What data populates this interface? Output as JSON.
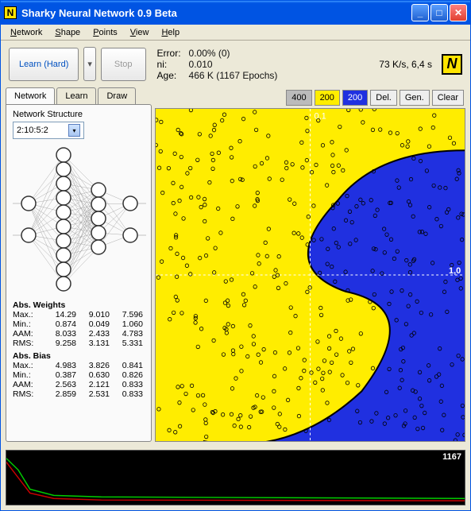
{
  "title": "Sharky Neural Network 0.9 Beta",
  "menu": {
    "network": "Network",
    "shape": "Shape",
    "points": "Points",
    "view": "View",
    "help": "Help"
  },
  "toolbar": {
    "learn": "Learn (Hard)",
    "drop": "▾",
    "stop": "Stop"
  },
  "stats": {
    "error_lbl": "Error:",
    "error": "0.00% (0)",
    "ni_lbl": "ni:",
    "ni": "0.010",
    "age_lbl": "Age:",
    "age": "466 K (1167 Epochs)"
  },
  "perf": "73 K/s, 6,4 s",
  "tabs": {
    "network": "Network",
    "learn": "Learn",
    "draw": "Draw"
  },
  "structure": {
    "label": "Network Structure",
    "value": "2:10:5:2"
  },
  "weights": {
    "title": "Abs. Weights",
    "rows": [
      {
        "n": "Max.:",
        "a": "14.29",
        "b": "9.010",
        "c": "7.596"
      },
      {
        "n": "Min.:",
        "a": "0.874",
        "b": "0.049",
        "c": "1.060"
      },
      {
        "n": "AAM:",
        "a": "8.033",
        "b": "2.433",
        "c": "4.783"
      },
      {
        "n": "RMS:",
        "a": "9.258",
        "b": "3.131",
        "c": "5.331"
      }
    ]
  },
  "bias": {
    "title": "Abs. Bias",
    "rows": [
      {
        "n": "Max.:",
        "a": "4.983",
        "b": "3.826",
        "c": "0.841"
      },
      {
        "n": "Min.:",
        "a": "0.387",
        "b": "0.630",
        "c": "0.826"
      },
      {
        "n": "AAM:",
        "a": "2.563",
        "b": "2.121",
        "c": "0.833"
      },
      {
        "n": "RMS:",
        "a": "2.859",
        "b": "2.531",
        "c": "0.833"
      }
    ]
  },
  "plotbar": {
    "p400": "400",
    "y200": "200",
    "b200": "200",
    "del": "Del.",
    "gen": "Gen.",
    "clear": "Clear"
  },
  "plotaxis": {
    "top": "0,1",
    "right": "1,0"
  },
  "chart_data": {
    "type": "scatter",
    "regions": [
      {
        "name": "yellow",
        "color": "#ffed00"
      },
      {
        "name": "blue",
        "color": "#2030e0"
      }
    ],
    "axis": {
      "xlabel": "",
      "ylabel": "",
      "x_mark": "0,1",
      "y_mark": "1,0"
    },
    "points_note": "~400 scattered sample points across two class regions; decision boundary is curved (blue region bulges left in mid-plot)",
    "epoch_counter": 1167,
    "loss_curves": [
      {
        "name": "green",
        "approx": "sharp drop then flat low"
      },
      {
        "name": "red",
        "approx": "sharp drop then flat low"
      }
    ]
  },
  "bottom": {
    "counter": "1167"
  }
}
